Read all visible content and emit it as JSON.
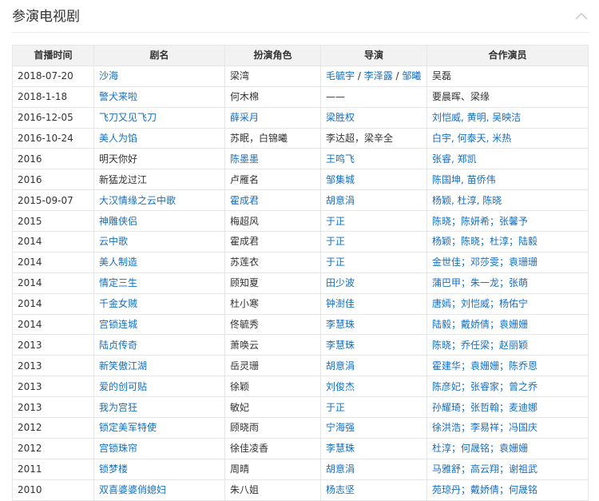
{
  "section": {
    "title": "参演电视剧",
    "toggle_icon": "chevron-up-icon"
  },
  "colors": {
    "link": "#136ec2",
    "text": "#333333",
    "header_bg": "#f2f2f2",
    "border": "#e6e6e6"
  },
  "table": {
    "headers": [
      "首播时间",
      "剧名",
      "扮演角色",
      "导演",
      "合作演员"
    ],
    "rows": [
      {
        "date": "2018-07-20",
        "title": {
          "text": "沙海",
          "link": true
        },
        "role": {
          "text": "梁湾",
          "link": false
        },
        "director": [
          {
            "text": "毛毓宇",
            "link": true
          },
          {
            "text": "李泽露",
            "link": true
          },
          {
            "text": "邹曦",
            "link": true
          }
        ],
        "costars": [
          {
            "text": "吴磊",
            "link": false
          }
        ]
      },
      {
        "date": "2018-1-18",
        "title": {
          "text": "警犬来啦",
          "link": true
        },
        "role": {
          "text": "何木棉",
          "link": false
        },
        "director": [
          {
            "text": "——",
            "link": false
          }
        ],
        "costars": [
          {
            "text": "要晨晖、梁缘",
            "link": false
          }
        ]
      },
      {
        "date": "2016-12-05",
        "title": {
          "text": "飞刀又见飞刀",
          "link": true
        },
        "role": {
          "text": "薛采月",
          "link": true
        },
        "director": [
          {
            "text": "梁胜权",
            "link": true
          }
        ],
        "costars": [
          {
            "text": "刘恺威, 黄明, 吴映洁",
            "link": true
          }
        ]
      },
      {
        "date": "2016-10-24",
        "title": {
          "text": "美人为馅",
          "link": true
        },
        "role": {
          "text": "苏眠，白锦曦",
          "link": false
        },
        "director": [
          {
            "text": "李达超，梁辛全",
            "link": false
          }
        ],
        "costars": [
          {
            "text": "白宇, 何泰天, 米热",
            "link": true
          }
        ]
      },
      {
        "date": "2016",
        "title": {
          "text": "明天你好",
          "link": false
        },
        "role": {
          "text": "陈墨墨",
          "link": true
        },
        "director": [
          {
            "text": "王鸣飞",
            "link": true
          }
        ],
        "costars": [
          {
            "text": "张睿, 郑凯",
            "link": true
          }
        ]
      },
      {
        "date": "2016",
        "title": {
          "text": "新猛龙过江",
          "link": false
        },
        "role": {
          "text": "卢雁名",
          "link": false
        },
        "director": [
          {
            "text": "邹集城",
            "link": true
          }
        ],
        "costars": [
          {
            "text": "陈国坤, 苗侨伟",
            "link": true
          }
        ]
      },
      {
        "date": "2015-09-07",
        "title": {
          "text": "大汉情缘之云中歌",
          "link": true
        },
        "role": {
          "text": "霍成君",
          "link": true
        },
        "director": [
          {
            "text": "胡意涓",
            "link": true
          }
        ],
        "costars": [
          {
            "text": "杨颖, 杜淳, 陈晓",
            "link": true
          }
        ]
      },
      {
        "date": "2015",
        "title": {
          "text": "神雕侠侣",
          "link": true
        },
        "role": {
          "text": "梅超风",
          "link": false
        },
        "director": [
          {
            "text": "于正",
            "link": true
          }
        ],
        "costars": [
          {
            "text": "陈晓；陈妍希；张馨予",
            "link": true
          }
        ]
      },
      {
        "date": "2014",
        "title": {
          "text": "云中歌",
          "link": true
        },
        "role": {
          "text": "霍成君",
          "link": false
        },
        "director": [
          {
            "text": "于正",
            "link": true
          }
        ],
        "costars": [
          {
            "text": "杨颖；陈晓；杜淳；陆毅",
            "link": true
          }
        ]
      },
      {
        "date": "2014",
        "title": {
          "text": "美人制造",
          "link": true
        },
        "role": {
          "text": "苏莲衣",
          "link": false
        },
        "director": [
          {
            "text": "于正",
            "link": true
          }
        ],
        "costars": [
          {
            "text": "金世佳；邓莎雯；袁珊珊",
            "link": true
          }
        ]
      },
      {
        "date": "2014",
        "title": {
          "text": "情定三生",
          "link": true
        },
        "role": {
          "text": "顾知夏",
          "link": false
        },
        "director": [
          {
            "text": "田少波",
            "link": true
          }
        ],
        "costars": [
          {
            "text": "蒲巴甲；朱一龙；张萌",
            "link": true
          }
        ]
      },
      {
        "date": "2014",
        "title": {
          "text": "千金女贼",
          "link": true
        },
        "role": {
          "text": "杜小寒",
          "link": false
        },
        "director": [
          {
            "text": "钟澍佳",
            "link": true
          }
        ],
        "costars": [
          {
            "text": "唐嫣；刘恺威；杨佑宁",
            "link": true
          }
        ]
      },
      {
        "date": "2014",
        "title": {
          "text": "宫锁连城",
          "link": true
        },
        "role": {
          "text": "佟毓秀",
          "link": false
        },
        "director": [
          {
            "text": "李慧珠",
            "link": true
          }
        ],
        "costars": [
          {
            "text": "陆毅；戴娇倩；袁姗姗",
            "link": true
          }
        ]
      },
      {
        "date": "2013",
        "title": {
          "text": "陆贞传奇",
          "link": true
        },
        "role": {
          "text": "萧唤云",
          "link": false
        },
        "director": [
          {
            "text": "李慧珠",
            "link": true
          }
        ],
        "costars": [
          {
            "text": "陈晓；乔任梁；赵丽颖",
            "link": true
          }
        ]
      },
      {
        "date": "2013",
        "title": {
          "text": "新笑傲江湖",
          "link": true
        },
        "role": {
          "text": "岳灵珊",
          "link": false
        },
        "director": [
          {
            "text": "胡意涓",
            "link": true
          }
        ],
        "costars": [
          {
            "text": "霍建华；袁姗姗；陈乔恩",
            "link": true
          }
        ]
      },
      {
        "date": "2013",
        "title": {
          "text": "爱的创可贴",
          "link": true
        },
        "role": {
          "text": "徐颖",
          "link": false
        },
        "director": [
          {
            "text": "刘俊杰",
            "link": true
          }
        ],
        "costars": [
          {
            "text": "陈彦妃；张睿家；曾之乔",
            "link": true
          }
        ]
      },
      {
        "date": "2013",
        "title": {
          "text": "我为宫狂",
          "link": true
        },
        "role": {
          "text": "敏妃",
          "link": false
        },
        "director": [
          {
            "text": "于正",
            "link": true
          }
        ],
        "costars": [
          {
            "text": "孙耀琦；张哲翰；麦迪娜",
            "link": true
          }
        ]
      },
      {
        "date": "2012",
        "title": {
          "text": "锁定美军特使",
          "link": true
        },
        "role": {
          "text": "顾晓雨",
          "link": false
        },
        "director": [
          {
            "text": "宁海强",
            "link": true
          }
        ],
        "costars": [
          {
            "text": "徐洪浩；李易祥；冯国庆",
            "link": true
          }
        ]
      },
      {
        "date": "2012",
        "title": {
          "text": "宫锁珠帘",
          "link": true
        },
        "role": {
          "text": "徐佳凌香",
          "link": false
        },
        "director": [
          {
            "text": "李慧珠",
            "link": true
          }
        ],
        "costars": [
          {
            "text": "杜淳；何晟铭；袁姗姗",
            "link": true
          }
        ]
      },
      {
        "date": "2011",
        "title": {
          "text": "锁梦楼",
          "link": true
        },
        "role": {
          "text": "周晴",
          "link": false
        },
        "director": [
          {
            "text": "胡意涓",
            "link": true
          }
        ],
        "costars": [
          {
            "text": "马雅舒；高云翔；谢祖武",
            "link": true
          }
        ]
      },
      {
        "date": "2010",
        "title": {
          "text": "双喜婆婆俏媳妇",
          "link": true
        },
        "role": {
          "text": "朱八姐",
          "link": false
        },
        "director": [
          {
            "text": "杨志坚",
            "link": true
          }
        ],
        "costars": [
          {
            "text": "苑琼丹；戴娇倩；何晟铭",
            "link": true
          }
        ]
      }
    ]
  }
}
